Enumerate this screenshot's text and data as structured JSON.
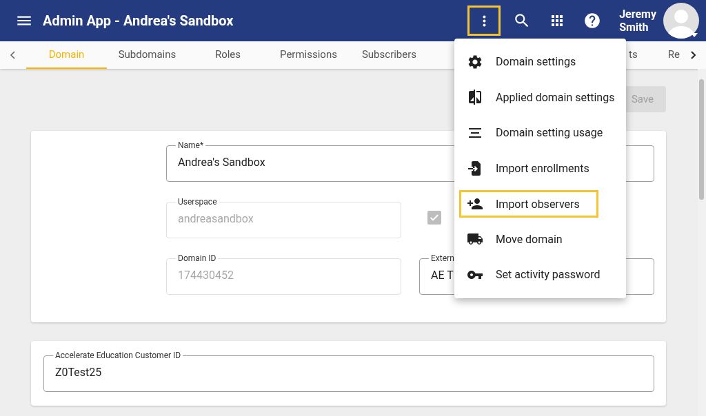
{
  "app_bar": {
    "title": "Admin App - Andrea's Sandbox",
    "more_button": {
      "highlighted": true
    },
    "user": {
      "first_name": "Jeremy",
      "last_name": "Smith"
    }
  },
  "tabs": [
    {
      "label": "Domain",
      "selected": true,
      "kind": "full"
    },
    {
      "label": "Subdomains",
      "selected": false,
      "kind": "full"
    },
    {
      "label": "Roles",
      "selected": false,
      "kind": "full"
    },
    {
      "label": "Permissions",
      "selected": false,
      "kind": "full"
    },
    {
      "label": "Subscribers",
      "selected": false,
      "kind": "full"
    },
    {
      "label": "ts",
      "selected": false,
      "kind": "partial"
    },
    {
      "label": "Re",
      "selected": false,
      "kind": "cut"
    }
  ],
  "save_button": {
    "label": "Save",
    "disabled": true
  },
  "domain_card": {
    "name": {
      "label": "Name*",
      "value": "Andrea's Sandbox",
      "disabled": false
    },
    "userspace": {
      "label": "Userspace",
      "value": "andreasandbox",
      "disabled": true
    },
    "checkbox": {
      "checked": true,
      "disabled": true
    },
    "domain_id": {
      "label": "Domain ID",
      "value": "174430452",
      "disabled": true
    },
    "external": {
      "label": "Extern",
      "value": "AE T",
      "disabled": false
    }
  },
  "customer_card": {
    "field": {
      "label": "Accelerate Education Customer ID",
      "value": "Z0Test25",
      "disabled": false
    }
  },
  "menu": {
    "items": [
      {
        "label": "Domain settings",
        "kind": "gear",
        "highlighted": false
      },
      {
        "label": "Applied domain settings",
        "kind": "compare",
        "highlighted": false
      },
      {
        "label": "Domain setting usage",
        "kind": "lines",
        "highlighted": false
      },
      {
        "label": "Import enrollments",
        "kind": "import",
        "highlighted": false
      },
      {
        "label": "Import observers",
        "kind": "person-add",
        "highlighted": true
      },
      {
        "label": "Move domain",
        "kind": "truck",
        "highlighted": false
      },
      {
        "label": "Set activity password",
        "kind": "key",
        "highlighted": false
      }
    ]
  }
}
